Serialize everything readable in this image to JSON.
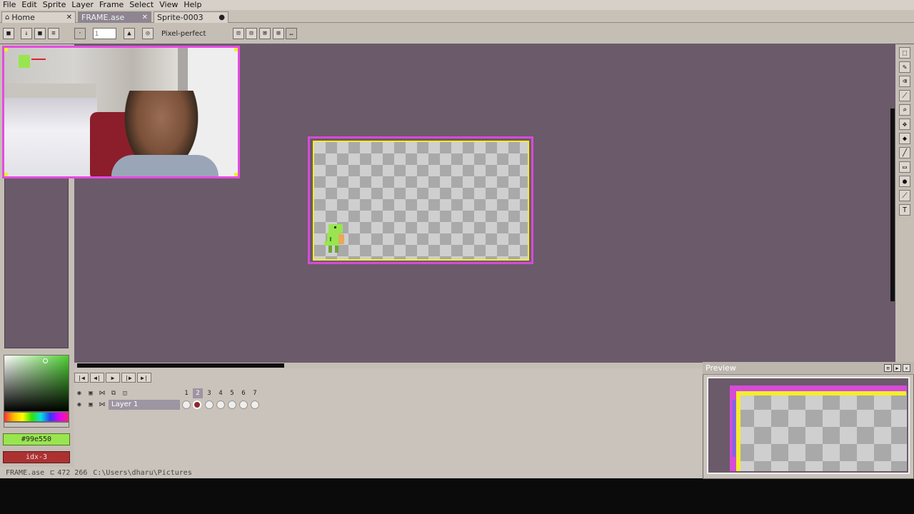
{
  "menu": {
    "items": [
      {
        "label": "File",
        "key": "F"
      },
      {
        "label": "Edit",
        "key": "E"
      },
      {
        "label": "Sprite",
        "key": "S"
      },
      {
        "label": "Layer",
        "key": "L"
      },
      {
        "label": "Frame",
        "key": "F"
      },
      {
        "label": "Select",
        "key": "S"
      },
      {
        "label": "View",
        "key": "V"
      },
      {
        "label": "Help",
        "key": "H"
      }
    ]
  },
  "tabs": [
    {
      "label": "Home",
      "icon": "home-icon",
      "active": false
    },
    {
      "label": "FRAME.ase",
      "active": true
    },
    {
      "label": "Sprite-0003",
      "modified": true,
      "active": false
    }
  ],
  "toolbar": {
    "brush_size": "1",
    "pixel_perfect_label": "Pixel-perfect"
  },
  "timeline": {
    "frames": [
      "1",
      "2",
      "3",
      "4",
      "5",
      "6",
      "7"
    ],
    "active_frame": "2",
    "layer_name": "Layer 1"
  },
  "colors": {
    "foreground_label": "#99e550",
    "background_label": "idx-3",
    "foreground": "#99e550",
    "background": "#ac3232",
    "workspace": "#6b5a6a",
    "frame_border": "#d64bd8",
    "selection_highlight": "#f2ee2a"
  },
  "preview": {
    "title": "Preview"
  },
  "status": {
    "filename": "FRAME.ase",
    "coords": "472 266",
    "path": "C:\\Users\\dharu\\Pictures"
  }
}
